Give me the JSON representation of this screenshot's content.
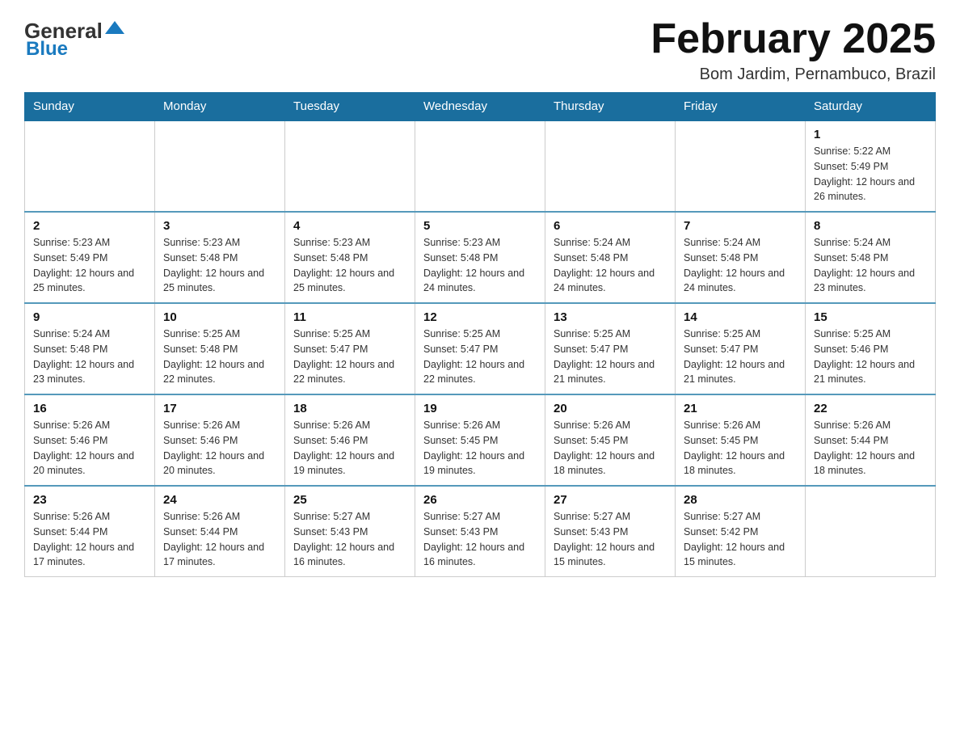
{
  "header": {
    "logo": {
      "general": "General",
      "blue": "Blue",
      "arrow": "▶"
    },
    "title": "February 2025",
    "location": "Bom Jardim, Pernambuco, Brazil"
  },
  "days_of_week": [
    "Sunday",
    "Monday",
    "Tuesday",
    "Wednesday",
    "Thursday",
    "Friday",
    "Saturday"
  ],
  "weeks": [
    [
      {
        "day": "",
        "info": ""
      },
      {
        "day": "",
        "info": ""
      },
      {
        "day": "",
        "info": ""
      },
      {
        "day": "",
        "info": ""
      },
      {
        "day": "",
        "info": ""
      },
      {
        "day": "",
        "info": ""
      },
      {
        "day": "1",
        "info": "Sunrise: 5:22 AM\nSunset: 5:49 PM\nDaylight: 12 hours and 26 minutes."
      }
    ],
    [
      {
        "day": "2",
        "info": "Sunrise: 5:23 AM\nSunset: 5:49 PM\nDaylight: 12 hours and 25 minutes."
      },
      {
        "day": "3",
        "info": "Sunrise: 5:23 AM\nSunset: 5:48 PM\nDaylight: 12 hours and 25 minutes."
      },
      {
        "day": "4",
        "info": "Sunrise: 5:23 AM\nSunset: 5:48 PM\nDaylight: 12 hours and 25 minutes."
      },
      {
        "day": "5",
        "info": "Sunrise: 5:23 AM\nSunset: 5:48 PM\nDaylight: 12 hours and 24 minutes."
      },
      {
        "day": "6",
        "info": "Sunrise: 5:24 AM\nSunset: 5:48 PM\nDaylight: 12 hours and 24 minutes."
      },
      {
        "day": "7",
        "info": "Sunrise: 5:24 AM\nSunset: 5:48 PM\nDaylight: 12 hours and 24 minutes."
      },
      {
        "day": "8",
        "info": "Sunrise: 5:24 AM\nSunset: 5:48 PM\nDaylight: 12 hours and 23 minutes."
      }
    ],
    [
      {
        "day": "9",
        "info": "Sunrise: 5:24 AM\nSunset: 5:48 PM\nDaylight: 12 hours and 23 minutes."
      },
      {
        "day": "10",
        "info": "Sunrise: 5:25 AM\nSunset: 5:48 PM\nDaylight: 12 hours and 22 minutes."
      },
      {
        "day": "11",
        "info": "Sunrise: 5:25 AM\nSunset: 5:47 PM\nDaylight: 12 hours and 22 minutes."
      },
      {
        "day": "12",
        "info": "Sunrise: 5:25 AM\nSunset: 5:47 PM\nDaylight: 12 hours and 22 minutes."
      },
      {
        "day": "13",
        "info": "Sunrise: 5:25 AM\nSunset: 5:47 PM\nDaylight: 12 hours and 21 minutes."
      },
      {
        "day": "14",
        "info": "Sunrise: 5:25 AM\nSunset: 5:47 PM\nDaylight: 12 hours and 21 minutes."
      },
      {
        "day": "15",
        "info": "Sunrise: 5:25 AM\nSunset: 5:46 PM\nDaylight: 12 hours and 21 minutes."
      }
    ],
    [
      {
        "day": "16",
        "info": "Sunrise: 5:26 AM\nSunset: 5:46 PM\nDaylight: 12 hours and 20 minutes."
      },
      {
        "day": "17",
        "info": "Sunrise: 5:26 AM\nSunset: 5:46 PM\nDaylight: 12 hours and 20 minutes."
      },
      {
        "day": "18",
        "info": "Sunrise: 5:26 AM\nSunset: 5:46 PM\nDaylight: 12 hours and 19 minutes."
      },
      {
        "day": "19",
        "info": "Sunrise: 5:26 AM\nSunset: 5:45 PM\nDaylight: 12 hours and 19 minutes."
      },
      {
        "day": "20",
        "info": "Sunrise: 5:26 AM\nSunset: 5:45 PM\nDaylight: 12 hours and 18 minutes."
      },
      {
        "day": "21",
        "info": "Sunrise: 5:26 AM\nSunset: 5:45 PM\nDaylight: 12 hours and 18 minutes."
      },
      {
        "day": "22",
        "info": "Sunrise: 5:26 AM\nSunset: 5:44 PM\nDaylight: 12 hours and 18 minutes."
      }
    ],
    [
      {
        "day": "23",
        "info": "Sunrise: 5:26 AM\nSunset: 5:44 PM\nDaylight: 12 hours and 17 minutes."
      },
      {
        "day": "24",
        "info": "Sunrise: 5:26 AM\nSunset: 5:44 PM\nDaylight: 12 hours and 17 minutes."
      },
      {
        "day": "25",
        "info": "Sunrise: 5:27 AM\nSunset: 5:43 PM\nDaylight: 12 hours and 16 minutes."
      },
      {
        "day": "26",
        "info": "Sunrise: 5:27 AM\nSunset: 5:43 PM\nDaylight: 12 hours and 16 minutes."
      },
      {
        "day": "27",
        "info": "Sunrise: 5:27 AM\nSunset: 5:43 PM\nDaylight: 12 hours and 15 minutes."
      },
      {
        "day": "28",
        "info": "Sunrise: 5:27 AM\nSunset: 5:42 PM\nDaylight: 12 hours and 15 minutes."
      },
      {
        "day": "",
        "info": ""
      }
    ]
  ]
}
